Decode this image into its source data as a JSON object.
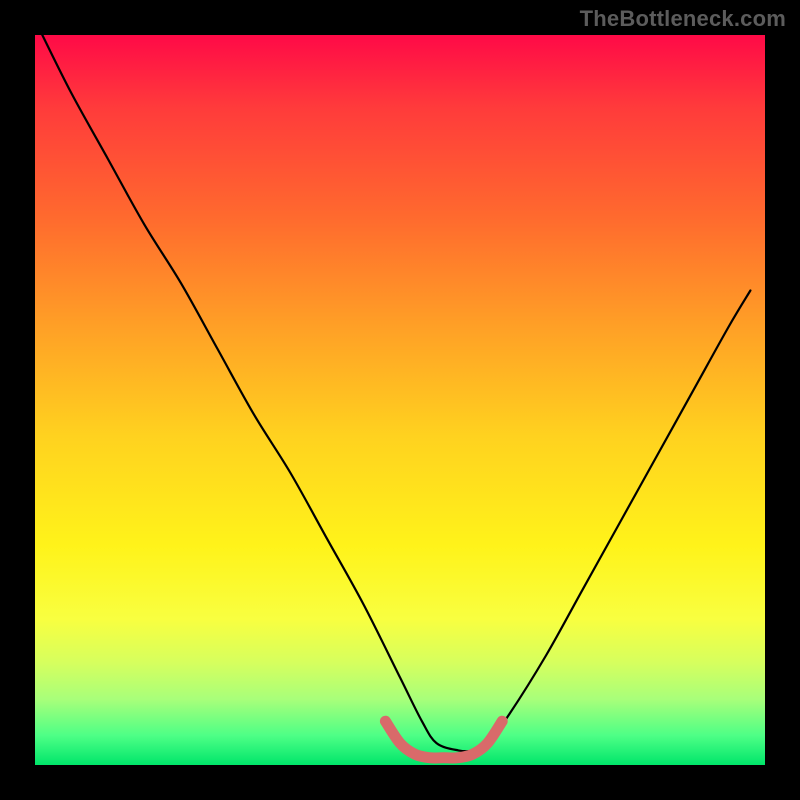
{
  "watermark": "TheBottleneck.com",
  "chart_data": {
    "type": "line",
    "title": "",
    "xlabel": "",
    "ylabel": "",
    "xlim": [
      0,
      100
    ],
    "ylim": [
      0,
      100
    ],
    "grid": false,
    "series": [
      {
        "name": "bottleneck-curve",
        "color": "#000000",
        "x": [
          1,
          5,
          10,
          15,
          20,
          25,
          30,
          35,
          40,
          45,
          50,
          53,
          55,
          58,
          60,
          62,
          65,
          70,
          75,
          80,
          85,
          90,
          95,
          98
        ],
        "values": [
          100,
          92,
          83,
          74,
          66,
          57,
          48,
          40,
          31,
          22,
          12,
          6,
          3,
          2,
          2,
          3,
          7,
          15,
          24,
          33,
          42,
          51,
          60,
          65
        ]
      },
      {
        "name": "optimal-range-marker",
        "color": "#d96a6a",
        "x": [
          48,
          50,
          52,
          54,
          56,
          58,
          60,
          62,
          64
        ],
        "values": [
          6,
          3,
          1.5,
          1,
          1,
          1,
          1.5,
          3,
          6
        ]
      }
    ],
    "background_gradient_stops": [
      {
        "pos": 0,
        "color": "#ff0a47"
      },
      {
        "pos": 25,
        "color": "#ff6a2e"
      },
      {
        "pos": 55,
        "color": "#ffd21f"
      },
      {
        "pos": 80,
        "color": "#f8ff40"
      },
      {
        "pos": 100,
        "color": "#00e56a"
      }
    ]
  }
}
